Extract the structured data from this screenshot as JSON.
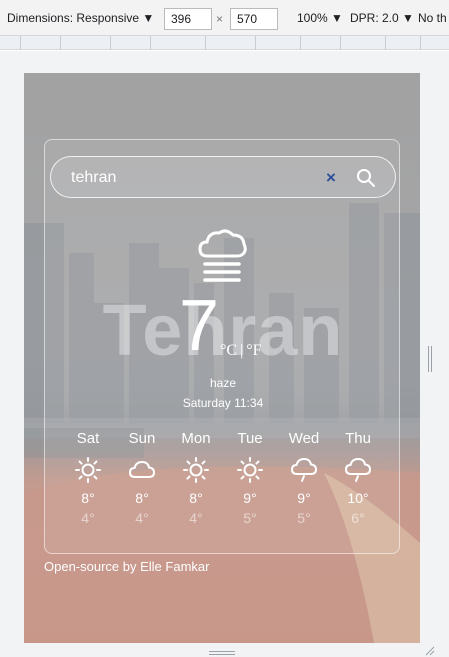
{
  "toolbar": {
    "dimensions_label": "Dimensions: Responsive",
    "width_value": "396",
    "times": "×",
    "height_value": "570",
    "zoom": "100%",
    "dpr": "DPR: 2.0",
    "throttle": "No th"
  },
  "search": {
    "value": "tehran",
    "clear_label": "×"
  },
  "current": {
    "icon": "haze-icon",
    "city": "Tehran",
    "temperature": "7",
    "unit_c": "°C",
    "unit_separator": "|",
    "unit_f": "°F",
    "condition": "haze",
    "datetime": "Saturday 11:34"
  },
  "forecast": [
    {
      "day": "Sat",
      "icon": "sun-icon",
      "high": "8°",
      "low": "4°"
    },
    {
      "day": "Sun",
      "icon": "cloud-icon",
      "high": "8°",
      "low": "4°"
    },
    {
      "day": "Mon",
      "icon": "sun-icon",
      "high": "8°",
      "low": "4°"
    },
    {
      "day": "Tue",
      "icon": "sun-icon",
      "high": "9°",
      "low": "5°"
    },
    {
      "day": "Wed",
      "icon": "rain-cloud-icon",
      "high": "9°",
      "low": "5°"
    },
    {
      "day": "Thu",
      "icon": "rain-cloud-icon",
      "high": "10°",
      "low": "6°"
    }
  ],
  "footer": "Open-source by Elle Famkar",
  "colors": {
    "clear_button": "#2d4e9a",
    "text": "#ffffff"
  }
}
